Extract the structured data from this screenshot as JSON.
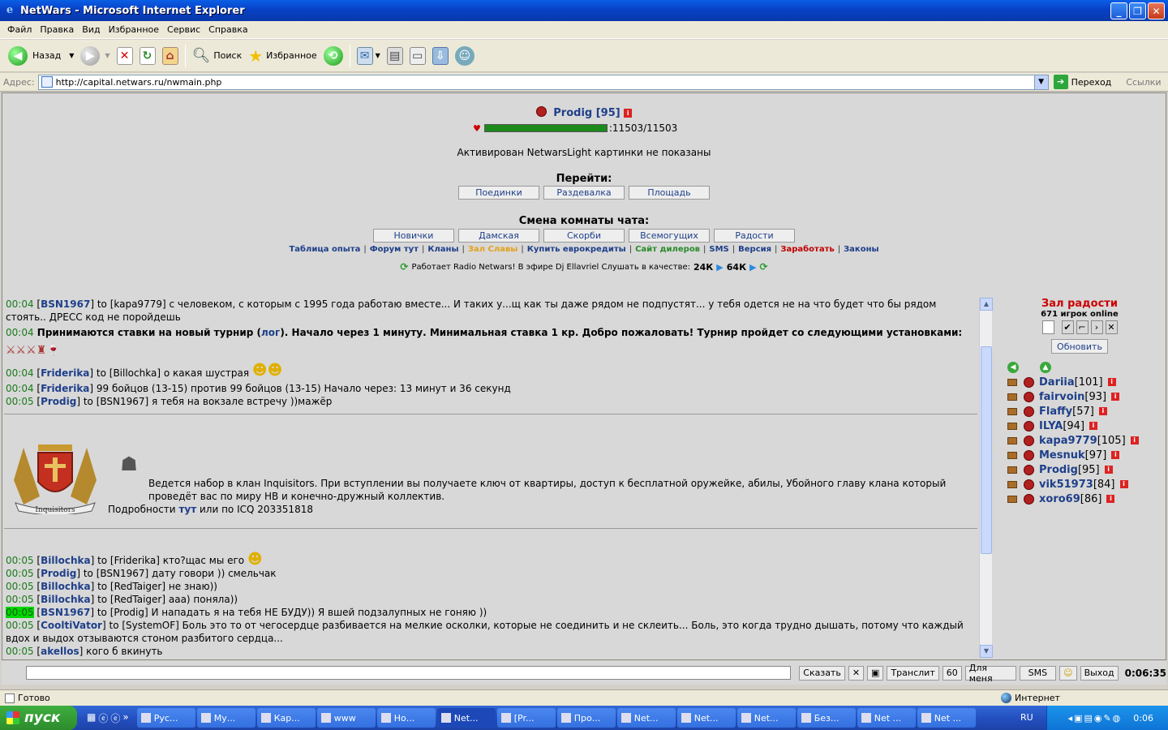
{
  "window": {
    "title": "NetWars - Microsoft Internet Explorer",
    "ie_glyph": "e"
  },
  "menu": [
    "Файл",
    "Правка",
    "Вид",
    "Избранное",
    "Сервис",
    "Справка"
  ],
  "toolbar": {
    "back": "Назад",
    "search": "Поиск",
    "favorites": "Избранное"
  },
  "address": {
    "label": "Адрес:",
    "url": "http://capital.netwars.ru/nwmain.php",
    "go": "Переход",
    "links": "Ссылки"
  },
  "player": {
    "name": "Prodig [95]",
    "hp": ":11503/11503"
  },
  "notice": "Активирован NetwarsLight картинки не показаны",
  "goto": {
    "title": "Перейти:",
    "buttons": [
      "Поединки",
      "Раздевалка",
      "Площадь"
    ]
  },
  "rooms": {
    "title": "Смена комнаты чата:",
    "buttons": [
      "Новички",
      "Дамская",
      "Скорби",
      "Всемогущих",
      "Радости"
    ]
  },
  "nav_links": [
    {
      "label": "Таблица опыта",
      "color": "#1e3f8a"
    },
    {
      "label": "Форум тут",
      "color": "#1e3f8a"
    },
    {
      "label": "Кланы",
      "color": "#1e3f8a"
    },
    {
      "label": "Зал Славы",
      "color": "#e3a21a"
    },
    {
      "label": "Купить еврокредиты",
      "color": "#1e3f8a"
    },
    {
      "label": "Сайт дилеров",
      "color": "#2a8a2a"
    },
    {
      "label": "SMS",
      "color": "#1e3f8a"
    },
    {
      "label": "Версия",
      "color": "#1e3f8a"
    },
    {
      "label": "Заработать",
      "color": "#c00000"
    },
    {
      "label": "Законы",
      "color": "#1e3f8a"
    }
  ],
  "radio": {
    "text": "Работает Radio Netwars! В эфире Dj Ellavriel Слушать в качестве:",
    "q1": "24К",
    "q2": "64К"
  },
  "chat": {
    "msg1": {
      "time": "00:04",
      "nick": "BSN1967",
      "text": "to [kapa9779] с человеком, с которым с 1995 года работаю вместе... И таких у...щ как ты даже рядом не подпустят... у тебя одется не на что будет что бы рядом стоять.. ДРЕСС код не поройдешь"
    },
    "msg2": {
      "time": "00:04",
      "text_a": "Принимаются ставки на новый турнир (",
      "link": "лог",
      "text_b": "). Начало через 1 минуту. Минимальная ставка 1 кр. Добро пожаловать! Турнир пройдет со следующими установками:"
    },
    "msg3": {
      "time": "00:04",
      "nick": "Friderika",
      "text": "to [Billochka] о какая шустрая"
    },
    "msg4": {
      "time": "00:04",
      "nick": "Friderika",
      "text": "99 бойцов (13-15) против 99 бойцов (13-15) Начало через: 13 минут и 36 секунд"
    },
    "msg5": {
      "time": "00:05",
      "nick": "Prodig",
      "text": "to [BSN1967] я тебя на вокзале встречу ))мажёр"
    },
    "clan": {
      "line1": "Ведется набор в клан Inquisitors. При вступлении вы получаете ключ от квартиры, доступ к бесплатной оружейке, абилы, Убойного главу клана который проведёт вас по миру НВ и конечно-дружный коллектив.",
      "line2_a": "Подробности",
      "line2_link": "тут",
      "line2_b": "или по ICQ 203351818",
      "crest_text": "Inquisitors"
    },
    "msg6": {
      "time": "00:05",
      "nick": "Billochka",
      "text": "to [Friderika] кто?щас мы его"
    },
    "msg7": {
      "time": "00:05",
      "nick": "Prodig",
      "text": "to [BSN1967] дату говори )) смельчак"
    },
    "msg8": {
      "time": "00:05",
      "nick": "Billochka",
      "text": "to [RedTaiger] не знаю))"
    },
    "msg9": {
      "time": "00:05",
      "nick": "Billochka",
      "text": "to [RedTaiger] ааа) поняла))"
    },
    "msg10": {
      "time": "00:05",
      "nick": "BSN1967",
      "text": "to [Prodig] И нападать я на тебя НЕ БУДУ)) Я вшей подзалупных не гоняю ))"
    },
    "msg11": {
      "time": "00:05",
      "nick": "CooltiVator",
      "text": "to [SystemOF] Боль это то от чегосердце разбивается на мелкие осколки, которые не соединить и не склеить... Боль, это когда трудно дышать, потому что каждый вдох и выдох отзываются стоном разбитого сердца..."
    },
    "msg12": {
      "time": "00:05",
      "nick": "akellos",
      "text": "кого б вкинуть"
    }
  },
  "room": {
    "name": "Зал радости",
    "online": "671 игрок online",
    "refresh": "Обновить"
  },
  "users": [
    {
      "name": "Dariia",
      "lvl": "[101]"
    },
    {
      "name": "fairvoin",
      "lvl": "[93]"
    },
    {
      "name": "Flaffy",
      "lvl": "[57]"
    },
    {
      "name": "ILYA",
      "lvl": "[94]"
    },
    {
      "name": "kapa9779",
      "lvl": "[105]"
    },
    {
      "name": "Mesnuk",
      "lvl": "[97]"
    },
    {
      "name": "Prodig",
      "lvl": "[95]"
    },
    {
      "name": "vik51973",
      "lvl": "[84]"
    },
    {
      "name": "xoro69",
      "lvl": "[86]"
    }
  ],
  "bottom": {
    "say": "Сказать",
    "translit": "Транслит",
    "count": "60",
    "forme": "Для меня",
    "sms": "SMS",
    "exit": "Выход",
    "timer": "0:06:35"
  },
  "status": {
    "ready": "Готово",
    "zone": "Интернет"
  },
  "taskbar": {
    "start": "пуск",
    "tasks": [
      "Рус...",
      "Му...",
      "Кар...",
      "www",
      "Но...",
      "Net...",
      "[Pr...",
      "Про...",
      "Net...",
      "Net...",
      "Net...",
      "Без...",
      "Net ...",
      "Net ..."
    ],
    "lang": "RU",
    "clock": "0:06"
  }
}
